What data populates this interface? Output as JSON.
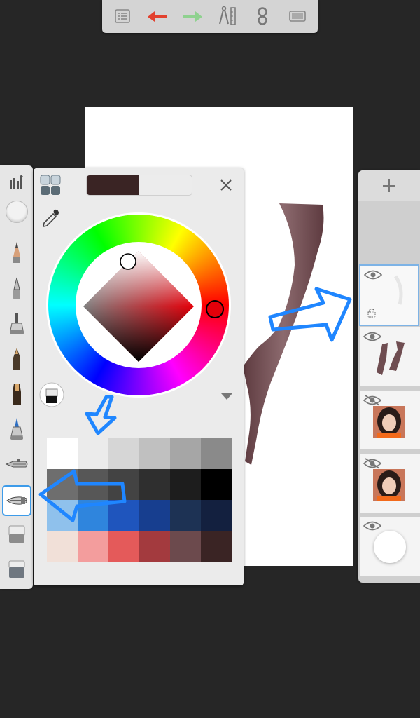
{
  "toolbar": {
    "items": [
      {
        "icon": "list-menu-icon"
      },
      {
        "icon": "undo-arrow-icon",
        "color": "#e2412e"
      },
      {
        "icon": "redo-arrow-icon",
        "color": "#8fd18f"
      },
      {
        "icon": "ruler-compass-icon"
      },
      {
        "icon": "symmetry-icon"
      },
      {
        "icon": "fullscreen-icon"
      }
    ]
  },
  "tools": {
    "items": [
      {
        "icon": "brush-library-icon"
      },
      {
        "icon": "brush-size-puck-icon"
      },
      {
        "icon": "pencil-icon"
      },
      {
        "icon": "ballpoint-pen-icon"
      },
      {
        "icon": "marker-icon"
      },
      {
        "icon": "fineliner-icon"
      },
      {
        "icon": "chisel-marker-icon"
      },
      {
        "icon": "ink-pen-icon"
      },
      {
        "icon": "airbrush-icon"
      },
      {
        "icon": "paint-brush-icon",
        "selected": true
      },
      {
        "icon": "eraser-icon"
      },
      {
        "icon": "hard-eraser-icon"
      }
    ]
  },
  "color_panel": {
    "current_color": "#3a2424",
    "hue_color": "#e4000a",
    "icons": [
      "palette-grid-icon",
      "eyedropper-icon",
      "close-icon",
      "color-fill-icon",
      "expand-down-icon"
    ],
    "palette": [
      [
        "#ffffff",
        "#ebebeb",
        "#d6d6d6",
        "#c0c0c0",
        "#a6a6a6",
        "#8a8a8a"
      ],
      [
        "#6e6e6e",
        "#575757",
        "#434343",
        "#2f2f2f",
        "#1d1d1d",
        "#000000"
      ],
      [
        "#8fc1ec",
        "#2f85dd",
        "#1f55bd",
        "#173e8f",
        "#1d3254",
        "#13203f"
      ],
      [
        "#f1e0d8",
        "#f39d9d",
        "#e45a5a",
        "#a33a3e",
        "#6c4a4d",
        "#3a2424"
      ]
    ]
  },
  "layers": {
    "add_icon": "add-layer-icon",
    "items": [
      {
        "name": "layer-sketch",
        "visible": true,
        "selected": true,
        "locked": true
      },
      {
        "name": "layer-brown-strokes",
        "visible": true,
        "selected": false
      },
      {
        "name": "layer-photo-1",
        "visible": false,
        "selected": false
      },
      {
        "name": "layer-photo-2",
        "visible": false,
        "selected": false
      },
      {
        "name": "layer-background",
        "visible": true,
        "selected": false
      }
    ]
  },
  "annotation_color": "#1f86ff",
  "stroke_color": "#6f4d51"
}
